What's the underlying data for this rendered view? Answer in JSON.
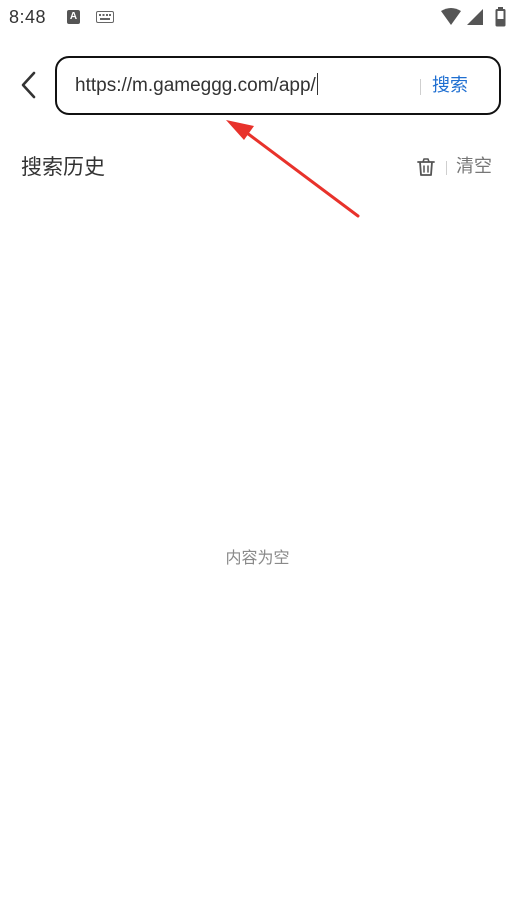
{
  "status_bar": {
    "time": "8:48",
    "notification_letter": "A",
    "icons": [
      "a-notification-icon",
      "keyboard-icon",
      "wifi-icon",
      "signal-icon",
      "battery-icon"
    ]
  },
  "search": {
    "value": "https://m.gameggg.com/app/",
    "button_label": "搜索"
  },
  "history": {
    "title": "搜索历史",
    "clear_label": "清空"
  },
  "empty": {
    "message": "内容为空"
  },
  "colors": {
    "accent": "#1f6fd1",
    "annotation_arrow": "#e8322b"
  }
}
